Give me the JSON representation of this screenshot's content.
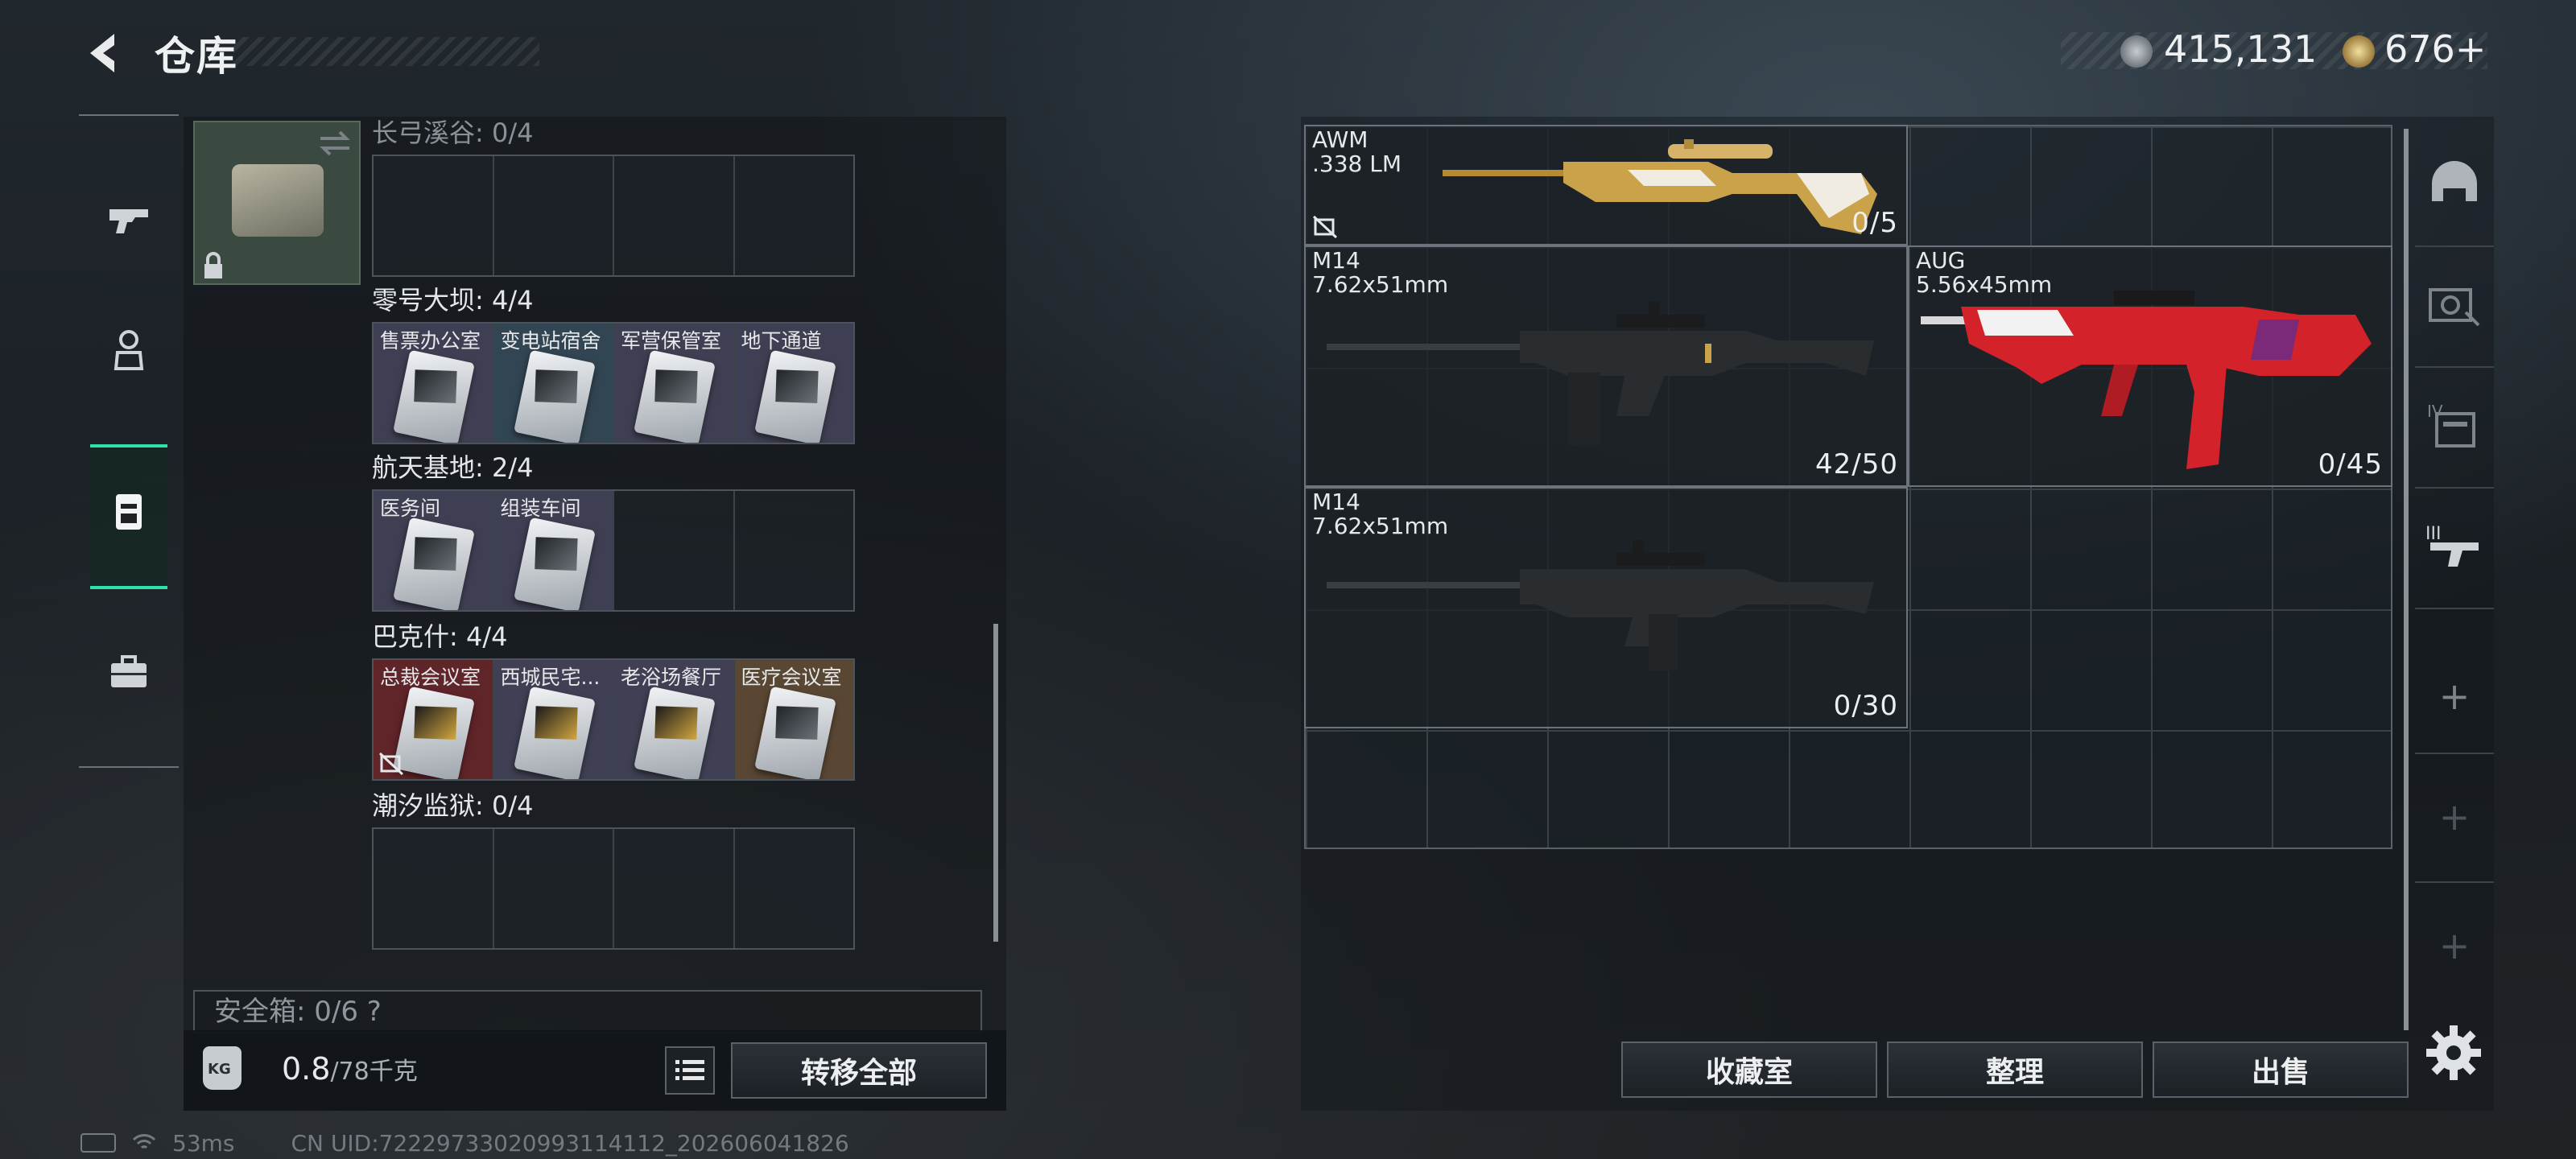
{
  "header": {
    "title": "仓库",
    "currency_silver": "415,131",
    "currency_gold": "676",
    "currency_gold_plus": "+"
  },
  "left_nav": {
    "items": [
      "pistol-icon",
      "operator-icon",
      "backpack-icon",
      "briefcase-icon"
    ],
    "active": "backpack-icon"
  },
  "container": {
    "top_partial_label": "长弓溪谷: 0/4",
    "sections": [
      {
        "label": "零号大坝: 4/4",
        "rooms": [
          "售票办公室",
          "变电站宿舍",
          "军营保管室",
          "地下通道"
        ]
      },
      {
        "label": "航天基地: 2/4",
        "rooms": [
          "医务间",
          "组装车间",
          "",
          ""
        ]
      },
      {
        "label": "巴克什: 4/4",
        "rooms": [
          "总裁会议室",
          "西城民宅...",
          "老浴场餐厅",
          "医疗会议室"
        ]
      },
      {
        "label": "潮汐监狱: 0/4",
        "rooms": [
          "",
          "",
          "",
          ""
        ]
      }
    ],
    "safe_box_label": "安全箱:  0/6",
    "safe_box_help": "?",
    "weight_unit_icon": "KG",
    "weight_value": "0.8",
    "weight_max": "/78千克",
    "transfer_all": "转移全部"
  },
  "weapons": [
    {
      "name": "AWM",
      "caliber": ".338 LM",
      "ammo": "0/5",
      "colors": [
        "#c9a24a",
        "#f1ece2"
      ]
    },
    {
      "name": "M14",
      "caliber": "7.62x51mm",
      "ammo": "42/50",
      "colors": [
        "#2a2d30",
        "#1a1c1e"
      ]
    },
    {
      "name": "AUG",
      "caliber": "5.56x45mm",
      "ammo": "0/45",
      "colors": [
        "#d3222a",
        "#f2f2f2"
      ]
    },
    {
      "name": "M14",
      "caliber": "7.62x51mm",
      "ammo": "0/30",
      "colors": [
        "#2a2d30",
        "#1a1c1e"
      ]
    }
  ],
  "right_nav": [
    "helmet-icon",
    "armor-icon",
    "rig-icon",
    "rifle-slot-icon",
    "add-slot-1",
    "add-slot-2",
    "add-slot-3"
  ],
  "buttons": {
    "collection": "收藏室",
    "sort": "整理",
    "sell": "出售"
  },
  "status": {
    "ping": "53ms",
    "uid": "CN UID:72229733020993114112_202606041826"
  }
}
